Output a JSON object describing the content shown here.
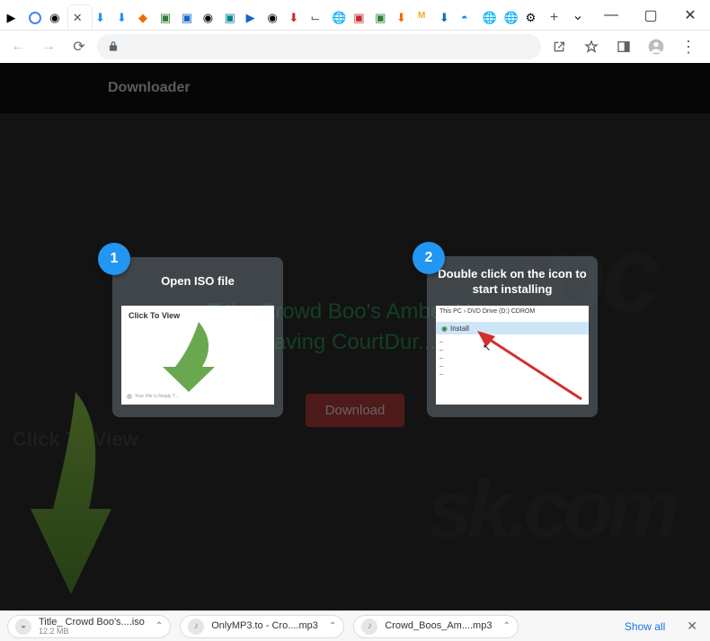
{
  "window": {
    "controls": {
      "dropdown": "⌄",
      "minimize": "—",
      "maximize": "▢",
      "close": "✕"
    }
  },
  "addrbar": {
    "lock": "lock"
  },
  "page": {
    "header": "Downloader",
    "title": "Title: Crowd Boo's Amber Hear   aving CourtDur...",
    "download_btn": "Download",
    "side_text": "Click To View"
  },
  "cards": [
    {
      "badge": "1",
      "title": "Open ISO file",
      "thumb_label": "Click To View",
      "thumb_footer": "Your File Is Ready T..."
    },
    {
      "badge": "2",
      "title": "Double click on the icon to start installing",
      "crumb": "This PC › DVD Drive (D:) CDROM",
      "row_label": "Install"
    }
  ],
  "downloads": {
    "items": [
      {
        "name": "Title_ Crowd Boo's....iso",
        "size": "12.2 MB"
      },
      {
        "name": "OnlyMP3.to - Cro....mp3",
        "size": ""
      },
      {
        "name": "Crowd_Boos_Am....mp3",
        "size": ""
      }
    ],
    "show_all": "Show all"
  },
  "tabs": {
    "new_tab": "+"
  }
}
